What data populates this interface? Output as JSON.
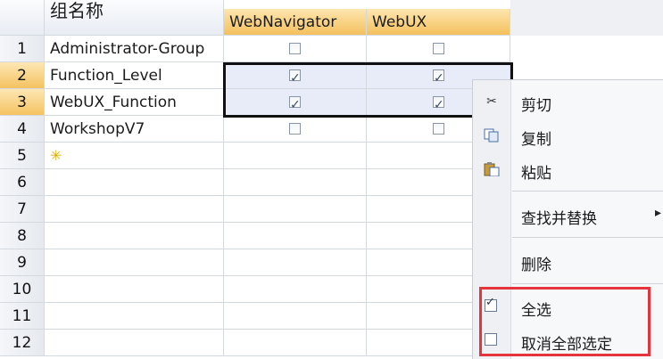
{
  "grid": {
    "headers": {
      "name": "组名称",
      "col1": "WebNavigator",
      "col2": "WebUX"
    },
    "rows": [
      {
        "num": "1",
        "name": "Administrator-Group",
        "c1": false,
        "c2": false
      },
      {
        "num": "2",
        "name": "Function_Level",
        "c1": true,
        "c2": true
      },
      {
        "num": "3",
        "name": "WebUX_Function",
        "c1": true,
        "c2": true
      },
      {
        "num": "4",
        "name": "WorkshopV7",
        "c1": false,
        "c2": false
      },
      {
        "num": "5",
        "name": "",
        "new_row_icon": "sparkle-icon"
      },
      {
        "num": "6",
        "name": ""
      },
      {
        "num": "7",
        "name": ""
      },
      {
        "num": "8",
        "name": ""
      },
      {
        "num": "9",
        "name": ""
      },
      {
        "num": "10",
        "name": ""
      },
      {
        "num": "11",
        "name": ""
      },
      {
        "num": "12",
        "name": ""
      }
    ]
  },
  "context_menu": {
    "cut": {
      "label": "剪切",
      "icon": "scissors-icon"
    },
    "copy": {
      "label": "复制",
      "icon": "copy-icon"
    },
    "paste": {
      "label": "粘贴",
      "icon": "paste-icon"
    },
    "find_replace": {
      "label": "查找并替换",
      "submenu_arrow": "▸"
    },
    "delete": {
      "label": "删除"
    },
    "select_all": {
      "label": "全选",
      "checked": true
    },
    "deselect_all": {
      "label": "取消全部选定",
      "checked": false
    }
  },
  "colors": {
    "highlight_box": "#e5343b",
    "selected_header": "#f5c260"
  }
}
